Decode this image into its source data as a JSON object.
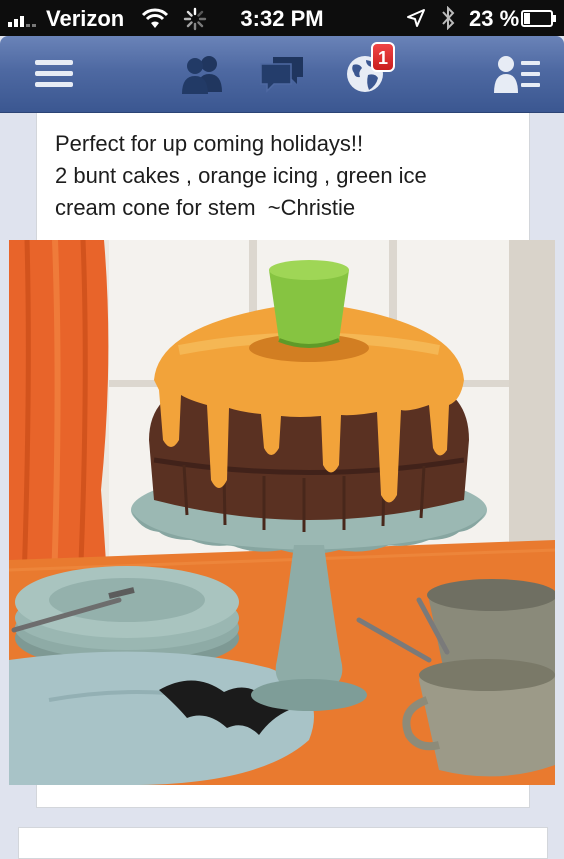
{
  "status_bar": {
    "carrier": "Verizon",
    "time": "3:32 PM",
    "battery_percent": "23 %",
    "battery_level": 0.23
  },
  "nav_bar": {
    "notification_count": "1",
    "icons": [
      "menu-icon",
      "friend-requests-icon",
      "messages-icon",
      "notifications-globe-icon",
      "profile-list-icon"
    ]
  },
  "post": {
    "text": "Perfect for up coming holidays!!\n2 bunt cakes , orange icing , green ice\ncream cone for stem  ~Christie"
  },
  "colors": {
    "nav_blue": "#3b5998",
    "badge_red": "#e02b2b",
    "icing_orange": "#f2a33a",
    "stem_green": "#86c441"
  }
}
